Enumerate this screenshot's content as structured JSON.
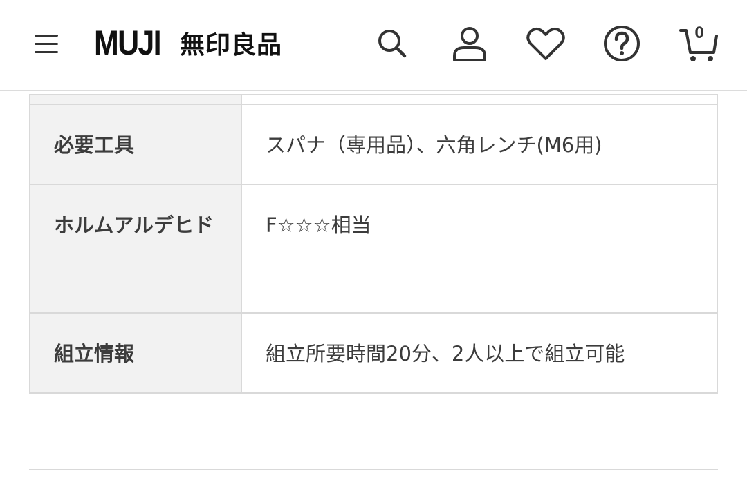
{
  "header": {
    "logo_latin": "MUJI",
    "logo_jp": "無印良品",
    "cart_count": "0"
  },
  "icons": {
    "menu": "hamburger-menu-icon",
    "search": "search-icon",
    "account": "user-icon",
    "favorites": "heart-icon",
    "help": "help-icon",
    "cart": "cart-icon"
  },
  "spec_table": {
    "rows": [
      {
        "label": "必要工具",
        "value": "スパナ（専用品）、六角レンチ(M6用)"
      },
      {
        "label": "ホルムアルデヒド",
        "value": "F☆☆☆相当"
      },
      {
        "label": "組立情報",
        "value": "組立所要時間20分、2人以上で組立可能"
      }
    ]
  }
}
